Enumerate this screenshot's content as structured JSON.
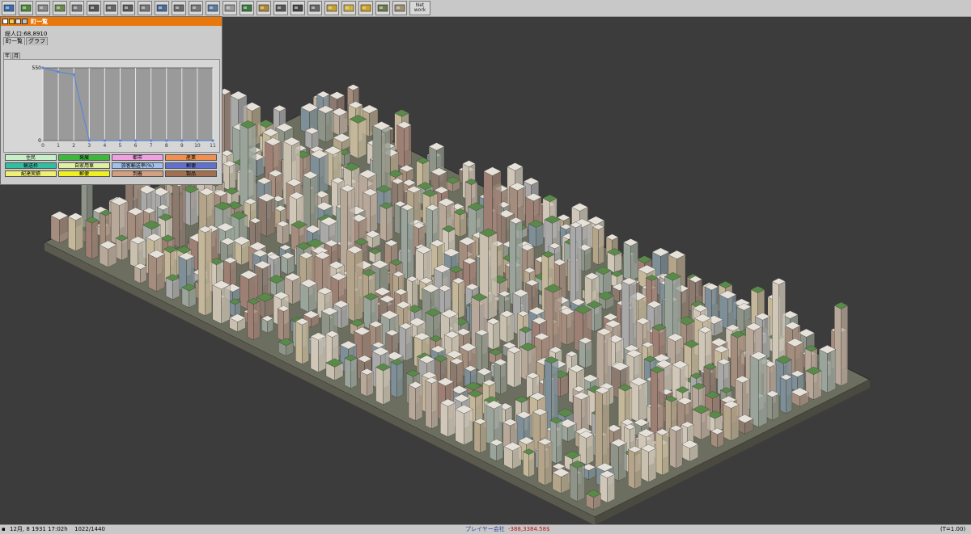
{
  "toolbar": {
    "icons": [
      "save-icon",
      "map-icon",
      "magnify-icon",
      "terrain-icon",
      "road-icon",
      "rail-icon",
      "tram-icon",
      "train-icon",
      "bus-icon",
      "airplane-icon",
      "ship-icon",
      "truck-icon",
      "plane-icon",
      "ship-icon",
      "tree-icon",
      "cargo-icon",
      "list-icon",
      "factory-icon",
      "camera-icon",
      "cabinet-icon",
      "money-icon",
      "help-icon",
      "minimap-icon",
      "grid-icon"
    ],
    "network_label_1": "Net",
    "network_label_2": "work"
  },
  "window": {
    "title": "町一覧",
    "population": "総人口:68,8910",
    "tabs": [
      "町一覧",
      "グラフ"
    ],
    "period_tabs": [
      "年",
      "月"
    ]
  },
  "chart_data": {
    "type": "line",
    "x": [
      0,
      1,
      2,
      3,
      4,
      5,
      6,
      7,
      8,
      9,
      10,
      11
    ],
    "series": [
      {
        "values": [
          550,
          520,
          500,
          0,
          0,
          0,
          0,
          0,
          0,
          0,
          0,
          0
        ],
        "color": "#5b87d6"
      }
    ],
    "ymax_label": "550",
    "ymin_label": "0",
    "ylim": [
      0,
      550
    ],
    "grid": true
  },
  "legend": [
    {
      "label": "住民",
      "color": "#c8f0c8"
    },
    {
      "label": "発展",
      "color": "#3cb83c"
    },
    {
      "label": "都市",
      "color": "#f0a0e0"
    },
    {
      "label": "産業",
      "color": "#f09050"
    },
    {
      "label": "輸送枠",
      "color": "#30c0a0"
    },
    {
      "label": "自家用車",
      "color": "#e0f0a0"
    },
    {
      "label": "旅客輸送率(%)",
      "color": "#a0c0f0"
    },
    {
      "label": "郵便",
      "color": "#6070d0"
    },
    {
      "label": "配達実績",
      "color": "#f0f070"
    },
    {
      "label": "郵便",
      "color": "#f0f020"
    },
    {
      "label": "到着",
      "color": "#d0a080"
    },
    {
      "label": "製品",
      "color": "#a07050"
    }
  ],
  "status": {
    "date": "12月, 8 1931 17:02h",
    "tiles": "1022/1440",
    "player_label": "プレイヤー会社",
    "money": "-388,3384.58$",
    "speed": "(T=1.00)"
  }
}
